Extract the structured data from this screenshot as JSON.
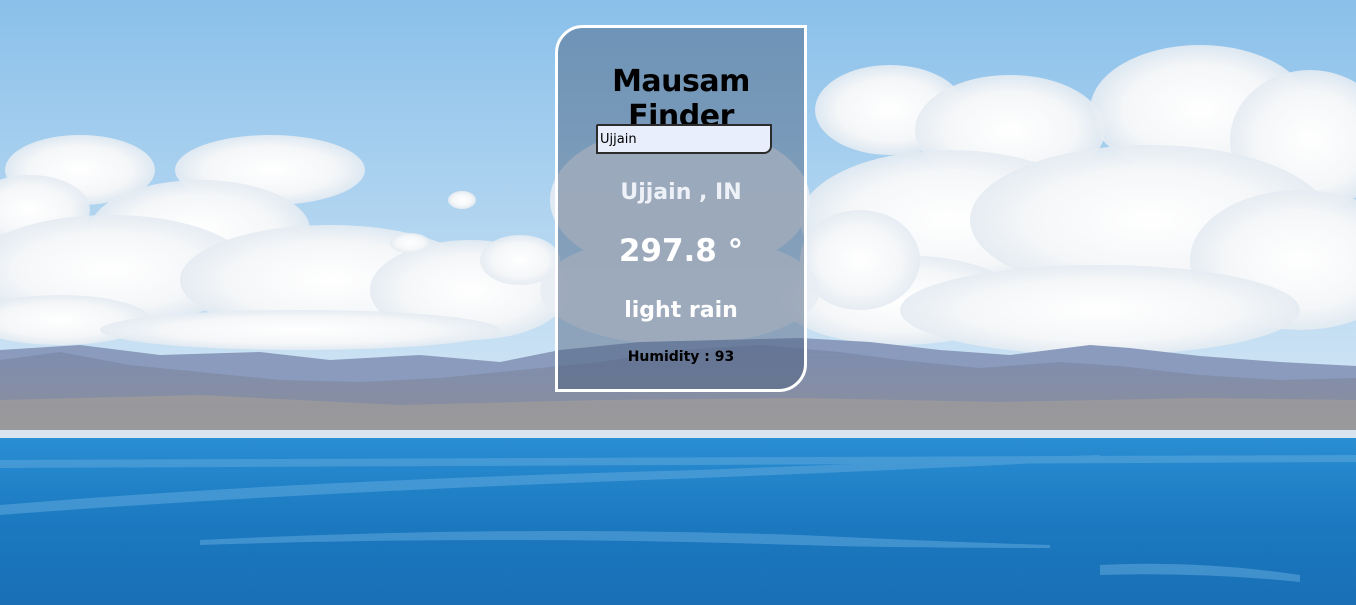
{
  "app": {
    "title": "Mausam Finder"
  },
  "search": {
    "value": "Ujjain"
  },
  "weather": {
    "location": "Ujjain , IN",
    "temperature": "297.8 °",
    "description": "light rain",
    "humidity": "Humidity : 93"
  },
  "colors": {
    "sky_top": "#8ec3ec",
    "sky_bottom": "#cfe4f4",
    "water": "#1e7fc6",
    "mountains": "#6f7fa3",
    "card_border": "#ffffff"
  }
}
